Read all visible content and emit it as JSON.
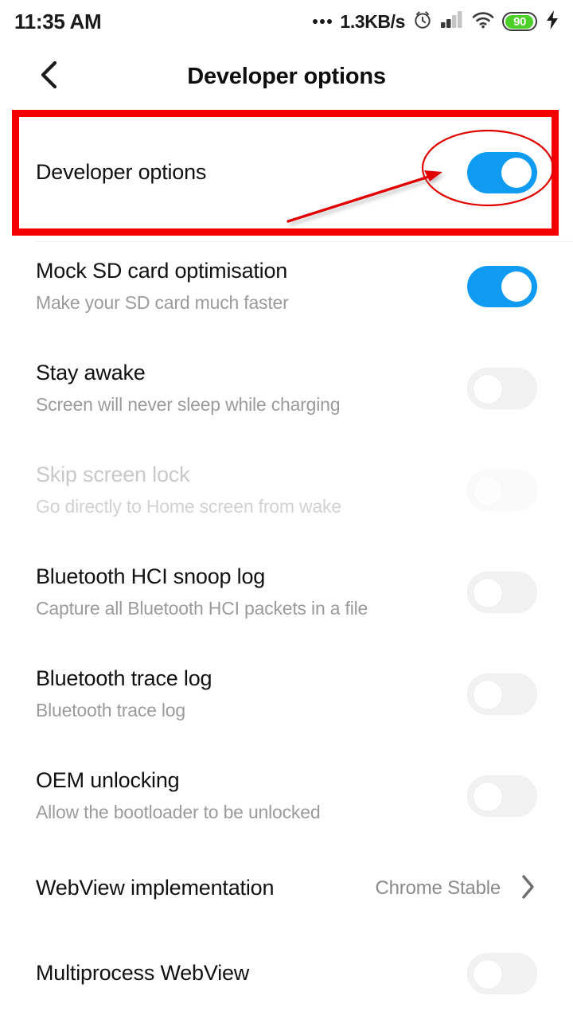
{
  "status_bar": {
    "time": "11:35 AM",
    "network_speed": "1.3KB/s",
    "speed_prefix_icon": "ellipsis-icon",
    "alarm_icon": "alarm-clock-icon",
    "signal_icon": "cellular-signal-icon",
    "wifi_icon": "wifi-icon",
    "battery_level": "90",
    "battery_icon": "battery-icon",
    "charging_icon": "lightning-bolt-icon",
    "battery_color": "#4ccf27"
  },
  "app_bar": {
    "back_icon": "back-chevron-icon",
    "title": "Developer options"
  },
  "annotation": {
    "box_color": "#f50000",
    "ellipse_color": "#e00000",
    "arrow_color": "#e00000"
  },
  "colors": {
    "toggle_on": "#0f9bf2",
    "toggle_off_track": "#f2f2f2",
    "title_text": "#111111",
    "sub_text": "#9b9b9b",
    "disabled_text": "#c9c9c9"
  },
  "settings": [
    {
      "title": "Developer options",
      "subtitle": "",
      "control": "toggle",
      "state": "on",
      "disabled": false,
      "highlighted": true
    },
    {
      "title": "Mock SD card optimisation",
      "subtitle": "Make your SD card much faster",
      "control": "toggle",
      "state": "on",
      "disabled": false,
      "highlighted": false
    },
    {
      "title": "Stay awake",
      "subtitle": "Screen will never sleep while charging",
      "control": "toggle",
      "state": "off",
      "disabled": false,
      "highlighted": false
    },
    {
      "title": "Skip screen lock",
      "subtitle": "Go directly to Home screen from wake",
      "control": "toggle",
      "state": "off",
      "disabled": true,
      "highlighted": false
    },
    {
      "title": "Bluetooth HCI snoop log",
      "subtitle": "Capture all Bluetooth HCI packets in a file",
      "control": "toggle",
      "state": "off",
      "disabled": false,
      "highlighted": false
    },
    {
      "title": "Bluetooth trace log",
      "subtitle": "Bluetooth trace log",
      "control": "toggle",
      "state": "off",
      "disabled": false,
      "highlighted": false
    },
    {
      "title": "OEM unlocking",
      "subtitle": "Allow the bootloader to be unlocked",
      "control": "toggle",
      "state": "off",
      "disabled": false,
      "highlighted": false
    },
    {
      "title": "WebView implementation",
      "subtitle": "",
      "control": "value-chevron",
      "value": "Chrome Stable",
      "chevron_icon": "chevron-right-icon",
      "disabled": false,
      "highlighted": false
    },
    {
      "title": "Multiprocess WebView",
      "subtitle": "",
      "control": "toggle",
      "state": "off",
      "disabled": false,
      "highlighted": false
    }
  ]
}
